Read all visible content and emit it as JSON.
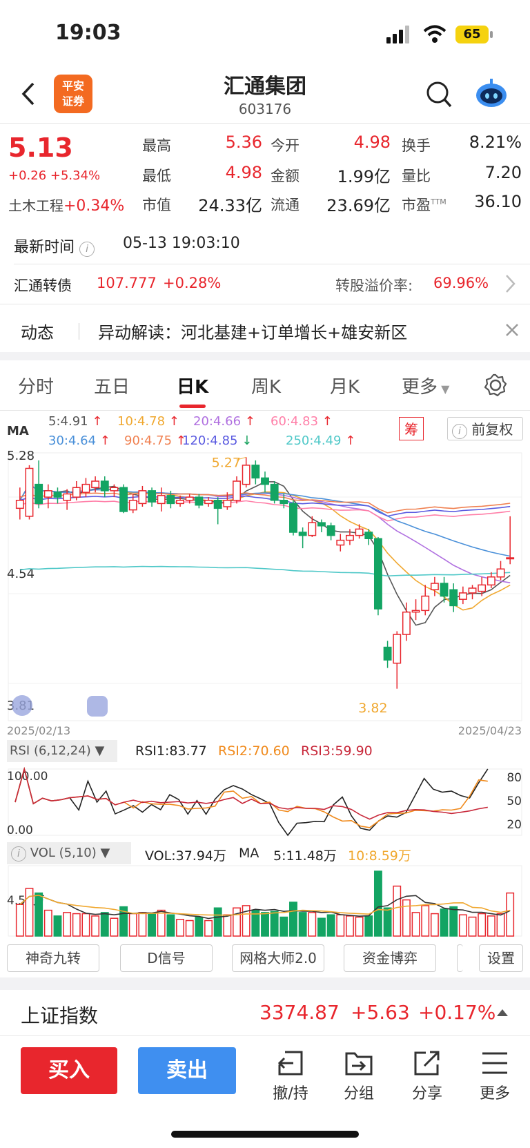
{
  "status": {
    "time": "19:03",
    "battery": "65"
  },
  "header": {
    "name": "汇通集团",
    "code": "603176",
    "logo": "平安\n证券"
  },
  "quote": {
    "price": "5.13",
    "change": "+0.26 +5.34%",
    "sector_label": "土木工程",
    "sector_change": "+0.34%",
    "fields": [
      {
        "label": "最高",
        "value": "5.36",
        "color": "red"
      },
      {
        "label": "今开",
        "value": "4.98",
        "color": "red"
      },
      {
        "label": "换手",
        "value": "8.21%",
        "color": "black"
      },
      {
        "label": "最低",
        "value": "4.98",
        "color": "red"
      },
      {
        "label": "金额",
        "value": "1.99亿",
        "color": "black"
      },
      {
        "label": "量比",
        "value": "7.20",
        "color": "black"
      },
      {
        "label": "市值",
        "value": "24.33亿",
        "color": "black"
      },
      {
        "label": "流通",
        "value": "23.69亿",
        "color": "black"
      },
      {
        "label": "市盈",
        "value": "36.10",
        "color": "black",
        "sup": "TTM"
      }
    ]
  },
  "latest_time": {
    "label": "最新时间",
    "value": "05-13 19:03:10"
  },
  "bond": {
    "label": "汇通转债",
    "price": "107.777",
    "change": "+0.28%",
    "premium_label": "转股溢价率:",
    "premium_value": "69.96%"
  },
  "dynamic": {
    "label": "动态",
    "text": "异动解读：河北基建+订单增长+雄安新区"
  },
  "tabs": [
    "分时",
    "五日",
    "日K",
    "周K",
    "月K",
    "更多"
  ],
  "active_tab": "日K",
  "ma_legend": {
    "label": "MA",
    "items": [
      {
        "text": "5:4.91",
        "arrow": "↑",
        "color": "#555555"
      },
      {
        "text": "10:4.78",
        "arrow": "↑",
        "color": "#f0a830"
      },
      {
        "text": "20:4.66",
        "arrow": "↑",
        "color": "#b070e0"
      },
      {
        "text": "60:4.83",
        "arrow": "↑",
        "color": "#ff7fa8"
      },
      {
        "text": "30:4.64",
        "arrow": "↑",
        "color": "#4a90d9"
      },
      {
        "text": "90:4.75",
        "arrow": "↑",
        "color": "#f08050"
      },
      {
        "text": "120:4.85",
        "arrow": "↓",
        "color": "#5a5ae0"
      },
      {
        "text": "250:4.49",
        "arrow": "↑",
        "color": "#4fc8c8"
      }
    ],
    "chou": "筹",
    "adjust": "前复权"
  },
  "chart_data": {
    "type": "candlestick",
    "y_ticks": [
      "5.28",
      "4.54",
      "3.81"
    ],
    "x_labels": [
      "2025/02/13",
      "2025/04/23"
    ],
    "high_label": "5.27",
    "low_label": "3.82",
    "candles": [
      [
        4.95,
        5.0,
        4.88,
        5.08
      ],
      [
        4.9,
        5.2,
        4.88,
        5.22
      ],
      [
        5.1,
        4.98,
        4.95,
        5.25
      ],
      [
        5.02,
        5.06,
        4.95,
        5.1
      ],
      [
        5.05,
        5.02,
        4.98,
        5.08
      ],
      [
        5.0,
        5.04,
        4.94,
        5.07
      ],
      [
        5.02,
        5.08,
        5.0,
        5.12
      ],
      [
        5.05,
        5.1,
        5.02,
        5.14
      ],
      [
        5.08,
        5.12,
        5.05,
        5.15
      ],
      [
        5.12,
        5.06,
        5.02,
        5.15
      ],
      [
        5.06,
        5.08,
        5.02,
        5.1
      ],
      [
        5.08,
        4.93,
        4.92,
        5.1
      ],
      [
        4.94,
        5.0,
        4.92,
        5.04
      ],
      [
        4.98,
        5.06,
        4.96,
        5.09
      ],
      [
        5.06,
        4.99,
        4.96,
        5.08
      ],
      [
        4.98,
        5.03,
        4.93,
        5.08
      ],
      [
        5.03,
        4.98,
        4.95,
        5.06
      ],
      [
        4.98,
        5.0,
        4.96,
        5.03
      ],
      [
        5.0,
        5.02,
        4.98,
        5.04
      ],
      [
        5.02,
        4.97,
        4.95,
        5.04
      ],
      [
        4.98,
        5.0,
        4.96,
        5.02
      ],
      [
        5.0,
        4.95,
        4.85,
        5.02
      ],
      [
        4.96,
        5.0,
        4.94,
        5.05
      ],
      [
        5.0,
        5.12,
        4.98,
        5.15
      ],
      [
        5.1,
        5.22,
        5.08,
        5.27
      ],
      [
        5.22,
        5.14,
        5.1,
        5.25
      ],
      [
        5.14,
        5.1,
        5.05,
        5.18
      ],
      [
        5.1,
        5.0,
        4.98,
        5.12
      ],
      [
        5.0,
        4.98,
        4.95,
        5.04
      ],
      [
        4.98,
        4.8,
        4.78,
        5.0
      ],
      [
        4.8,
        4.78,
        4.7,
        4.83
      ],
      [
        4.78,
        4.86,
        4.77,
        4.9
      ],
      [
        4.86,
        4.84,
        4.8,
        4.88
      ],
      [
        4.84,
        4.78,
        4.75,
        4.86
      ],
      [
        4.72,
        4.75,
        4.68,
        4.79
      ],
      [
        4.75,
        4.78,
        4.72,
        4.82
      ],
      [
        4.78,
        4.82,
        4.76,
        4.85
      ],
      [
        4.8,
        4.76,
        4.72,
        4.82
      ],
      [
        4.76,
        4.32,
        4.28,
        4.77
      ],
      [
        4.08,
        4.0,
        3.95,
        4.12
      ],
      [
        3.98,
        4.16,
        3.82,
        4.18
      ],
      [
        4.16,
        4.3,
        4.12,
        4.36
      ],
      [
        4.3,
        4.31,
        4.25,
        4.38
      ],
      [
        4.31,
        4.4,
        4.28,
        4.47
      ],
      [
        4.44,
        4.48,
        4.4,
        4.52
      ],
      [
        4.48,
        4.4,
        4.36,
        4.52
      ],
      [
        4.44,
        4.34,
        4.3,
        4.48
      ],
      [
        4.38,
        4.42,
        4.35,
        4.46
      ],
      [
        4.42,
        4.45,
        4.38,
        4.47
      ],
      [
        4.43,
        4.47,
        4.4,
        4.52
      ],
      [
        4.47,
        4.52,
        4.45,
        4.55
      ],
      [
        4.52,
        4.57,
        4.5,
        4.62
      ],
      [
        4.64,
        4.64,
        4.6,
        4.9
      ]
    ]
  },
  "rsi": {
    "label": "RSI (6,12,24)",
    "rsi1": "RSI1:83.77",
    "rsi2": "RSI2:70.60",
    "rsi3": "RSI3:59.90",
    "y_left": [
      "100.00",
      "0.00"
    ],
    "y_right": [
      "80",
      "50",
      "20"
    ]
  },
  "vol": {
    "label": "VOL (5,10)",
    "vol": "VOL:37.94万",
    "ma": "MA",
    "ma5": "5:11.48万",
    "ma10": "10:8.59万",
    "ylabel": "4.53万"
  },
  "chips": [
    "神奇九转",
    "D信号",
    "网格大师2.0",
    "资金博弈",
    "设置"
  ],
  "index": {
    "name": "上证指数",
    "value": "3374.87",
    "change": "+5.63",
    "pct": "+0.17%"
  },
  "actions": {
    "buy": "买入",
    "sell": "卖出",
    "tools": [
      "撤/持",
      "分组",
      "分享",
      "更多"
    ]
  }
}
